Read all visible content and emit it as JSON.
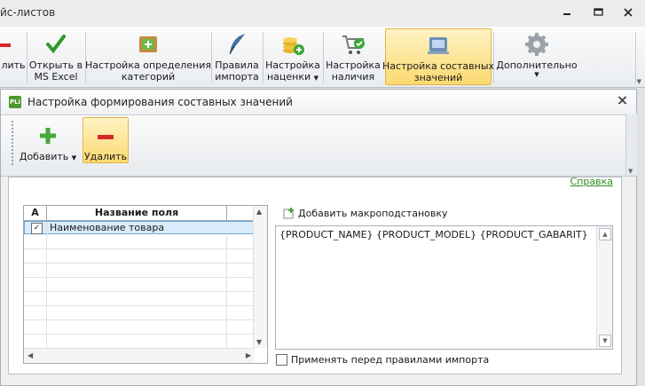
{
  "window": {
    "title": "йс-листов",
    "minimize_icon": "minimize-icon",
    "maximize_icon": "maximize-icon",
    "close_icon": "close-icon"
  },
  "ribbon": {
    "items": [
      {
        "label": "лить",
        "icon": "delete-icon"
      },
      {
        "label": "Открыть в\nMS Excel",
        "icon": "checkmark-icon"
      },
      {
        "label": "Настройка определения\nкатегорий",
        "icon": "category-icon"
      },
      {
        "label": "Правила\nимпорта",
        "icon": "quill-icon"
      },
      {
        "label": "Настройка\nнаценки",
        "icon": "coins-icon"
      },
      {
        "label": "Настройка\nналичия",
        "icon": "cart-icon"
      },
      {
        "label": "Настройка составных\nзначений",
        "icon": "composite-icon"
      },
      {
        "label": "Дополнительно",
        "icon": "gear-icon"
      }
    ]
  },
  "dialog": {
    "title": "Настройка формирования составных значений",
    "app_icon_text": "PLi",
    "toolbar": {
      "add_label": "Добавить",
      "delete_label": "Удалить"
    },
    "help_link": "Справка",
    "grid": {
      "col_a": "A",
      "col_name": "Название поля",
      "rows": [
        {
          "checked": true,
          "name": "Наименование товара"
        }
      ]
    },
    "macro": {
      "add_label": "Добавить макроподстановку",
      "value": "{PRODUCT_NAME} {PRODUCT_MODEL} {PRODUCT_GABARIT}"
    },
    "apply_before_import_label": "Применять перед правилами импорта"
  },
  "colors": {
    "active_button": "#fbd970",
    "link": "#2f8f1f",
    "selection": "#d9ecfb"
  }
}
